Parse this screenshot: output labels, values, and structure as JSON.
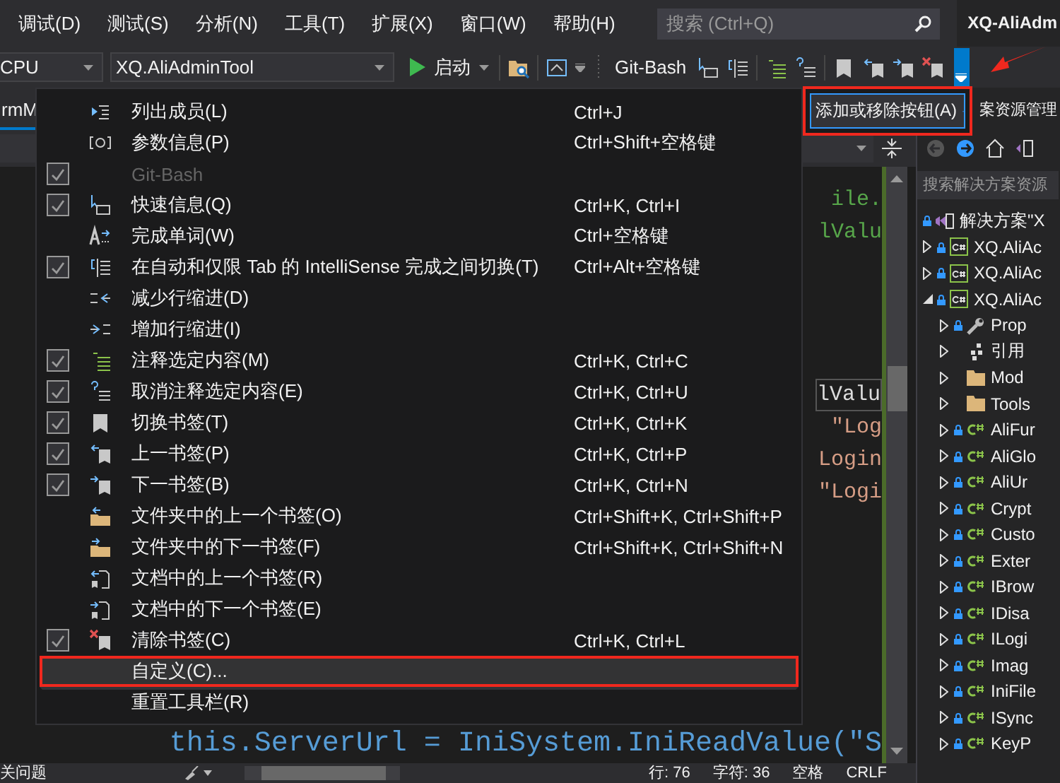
{
  "menubar": {
    "items": [
      "调试(D)",
      "测试(S)",
      "分析(N)",
      "工具(T)",
      "扩展(X)",
      "窗口(W)",
      "帮助(H)"
    ],
    "search": {
      "placeholder": "搜索 (Ctrl+Q)"
    },
    "title": "XQ-AliAdm"
  },
  "toolbar": {
    "platform": "CPU",
    "project": "XQ.AliAdminTool",
    "start": "启动",
    "git_bash": "Git-Bash",
    "overflow_active": true
  },
  "editor": {
    "tab": "rmM",
    "code_groups": [
      [
        {
          "text": "ile.",
          "kind": "comment",
          "highlighted": false
        },
        {
          "text": "lValu",
          "kind": "comment",
          "highlighted": false
        }
      ],
      [
        {
          "text": "lValu",
          "kind": "plain",
          "highlighted": true
        },
        {
          "text": "\"Log",
          "kind": "string",
          "highlighted": false
        },
        {
          "text": "Login",
          "kind": "string",
          "highlighted": false
        },
        {
          "text": "\"Logi",
          "kind": "string",
          "highlighted": false
        }
      ]
    ],
    "bottom_line": "this.ServerUrl = IniSystem.IniReadValue(\"S"
  },
  "menu": {
    "submenu": {
      "label": "添加或移除按钮(A)",
      "annotated": true
    },
    "items": [
      {
        "label": "列出成员(L)",
        "shortcut": "Ctrl+J",
        "kind": "toggle",
        "checked": false,
        "disabled": false,
        "selected": false,
        "annotated": false
      },
      {
        "label": "参数信息(P)",
        "shortcut": "Ctrl+Shift+空格键",
        "kind": "toggle",
        "checked": false,
        "disabled": false,
        "selected": false,
        "annotated": false
      },
      {
        "label": "Git-Bash",
        "kind": "toggle",
        "checked": true,
        "disabled": true,
        "selected": false,
        "annotated": false
      },
      {
        "label": "快速信息(Q)",
        "shortcut": "Ctrl+K, Ctrl+I",
        "kind": "toggle",
        "checked": true,
        "disabled": false,
        "selected": false,
        "annotated": false
      },
      {
        "label": "完成单词(W)",
        "shortcut": "Ctrl+空格键",
        "kind": "toggle",
        "checked": false,
        "disabled": false,
        "selected": false,
        "annotated": false
      },
      {
        "label": "在自动和仅限 Tab 的 IntelliSense 完成之间切换(T)",
        "shortcut": "Ctrl+Alt+空格键",
        "kind": "toggle",
        "checked": true,
        "disabled": false,
        "selected": false,
        "annotated": false
      },
      {
        "label": "减少行缩进(D)",
        "kind": "toggle",
        "checked": false,
        "disabled": false,
        "selected": false,
        "annotated": false
      },
      {
        "label": "增加行缩进(I)",
        "kind": "toggle",
        "checked": false,
        "disabled": false,
        "selected": false,
        "annotated": false
      },
      {
        "label": "注释选定内容(M)",
        "shortcut": "Ctrl+K, Ctrl+C",
        "kind": "toggle",
        "checked": true,
        "disabled": false,
        "selected": false,
        "annotated": false
      },
      {
        "label": "取消注释选定内容(E)",
        "shortcut": "Ctrl+K, Ctrl+U",
        "kind": "toggle",
        "checked": true,
        "disabled": false,
        "selected": false,
        "annotated": false
      },
      {
        "label": "切换书签(T)",
        "shortcut": "Ctrl+K, Ctrl+K",
        "kind": "toggle",
        "checked": true,
        "disabled": false,
        "selected": false,
        "annotated": false
      },
      {
        "label": "上一书签(P)",
        "shortcut": "Ctrl+K, Ctrl+P",
        "kind": "toggle",
        "checked": true,
        "disabled": false,
        "selected": false,
        "annotated": false
      },
      {
        "label": "下一书签(B)",
        "shortcut": "Ctrl+K, Ctrl+N",
        "kind": "toggle",
        "checked": true,
        "disabled": false,
        "selected": false,
        "annotated": false
      },
      {
        "label": "文件夹中的上一个书签(O)",
        "shortcut": "Ctrl+Shift+K, Ctrl+Shift+P",
        "kind": "toggle",
        "checked": false,
        "disabled": false,
        "selected": false,
        "annotated": false
      },
      {
        "label": "文件夹中的下一书签(F)",
        "shortcut": "Ctrl+Shift+K, Ctrl+Shift+N",
        "kind": "toggle",
        "checked": false,
        "disabled": false,
        "selected": false,
        "annotated": false
      },
      {
        "label": "文档中的上一个书签(R)",
        "kind": "toggle",
        "checked": false,
        "disabled": false,
        "selected": false,
        "annotated": false
      },
      {
        "label": "文档中的下一个书签(E)",
        "kind": "toggle",
        "checked": false,
        "disabled": false,
        "selected": false,
        "annotated": false
      },
      {
        "label": "清除书签(C)",
        "shortcut": "Ctrl+K, Ctrl+L",
        "kind": "toggle",
        "checked": true,
        "disabled": false,
        "selected": false,
        "annotated": false
      },
      {
        "label": "自定义(C)...",
        "kind": "command",
        "disabled": false,
        "selected": true,
        "annotated": true
      },
      {
        "label": "重置工具栏(R)",
        "kind": "command",
        "disabled": false,
        "selected": false,
        "annotated": false
      }
    ]
  },
  "solution_explorer": {
    "header": "案资源管理",
    "search": {
      "placeholder": "搜索解决方案资源"
    },
    "tree": [
      {
        "label": "解决方案\"X",
        "kind": "solution",
        "locked": true,
        "children": [
          {
            "label": "XQ.AliAc",
            "kind": "project",
            "locked": true,
            "expanded": false
          },
          {
            "label": "XQ.AliAc",
            "kind": "project",
            "locked": true,
            "expanded": false
          },
          {
            "label": "XQ.AliAc",
            "kind": "project",
            "locked": true,
            "expanded": true,
            "children": [
              {
                "label": "Prop",
                "kind": "properties",
                "locked": true,
                "expanded": false
              },
              {
                "label": "引用",
                "kind": "references",
                "locked": false,
                "expanded": false
              },
              {
                "label": "Mod",
                "kind": "folder",
                "locked": false,
                "expanded": false
              },
              {
                "label": "Tools",
                "kind": "folder",
                "locked": false,
                "expanded": false
              },
              {
                "label": "AliFur",
                "kind": "code",
                "locked": true,
                "expanded": false
              },
              {
                "label": "AliGlo",
                "kind": "code",
                "locked": true,
                "expanded": false
              },
              {
                "label": "AliUr",
                "kind": "code",
                "locked": true,
                "expanded": false
              },
              {
                "label": "Crypt",
                "kind": "code",
                "locked": true,
                "expanded": false
              },
              {
                "label": "Custo",
                "kind": "code",
                "locked": true,
                "expanded": false
              },
              {
                "label": "Exter",
                "kind": "code",
                "locked": true,
                "expanded": false
              },
              {
                "label": "IBrow",
                "kind": "code",
                "locked": true,
                "expanded": false
              },
              {
                "label": "IDisa",
                "kind": "code",
                "locked": true,
                "expanded": false
              },
              {
                "label": "ILogi",
                "kind": "code",
                "locked": true,
                "expanded": false
              },
              {
                "label": "Imag",
                "kind": "code",
                "locked": true,
                "expanded": false
              },
              {
                "label": "IniFile",
                "kind": "code",
                "locked": true,
                "expanded": false
              },
              {
                "label": "ISync",
                "kind": "code",
                "locked": true,
                "expanded": false
              },
              {
                "label": "KeyP",
                "kind": "code",
                "locked": true,
                "expanded": false
              }
            ]
          }
        ]
      }
    ]
  },
  "status_bar": {
    "panel": "关问题",
    "line": "行: 76",
    "column": "字符: 36",
    "spacing": "空格",
    "line_ending": "CRLF"
  }
}
